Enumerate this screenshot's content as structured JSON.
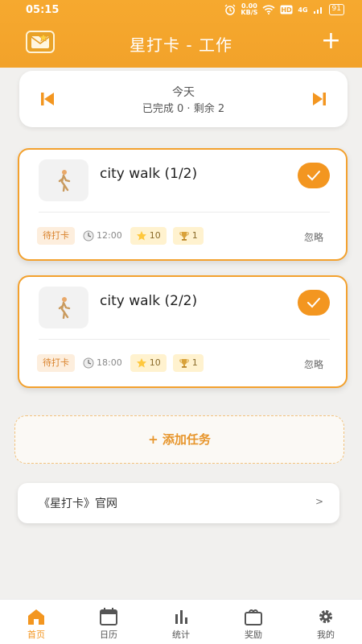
{
  "status_bar": {
    "time": "05:15",
    "speed_top": "0.00",
    "speed_bottom": "KB/S",
    "network": "4G",
    "battery": "91"
  },
  "header": {
    "title": "星打卡 - 工作",
    "add_label": "+"
  },
  "date_card": {
    "day_label": "今天",
    "summary": "已完成 0 · 剩余 2"
  },
  "tasks": [
    {
      "name": "city walk (1/2)",
      "status": "待打卡",
      "time": "12:00",
      "stars": "10",
      "trophies": "1",
      "ignore_label": "忽略"
    },
    {
      "name": "city walk (2/2)",
      "status": "待打卡",
      "time": "18:00",
      "stars": "10",
      "trophies": "1",
      "ignore_label": "忽略"
    }
  ],
  "add_task": {
    "label": "+ 添加任务"
  },
  "website": {
    "label": "《星打卡》官网",
    "chevron": ">"
  },
  "bottom_nav": {
    "items": [
      {
        "label": "首页",
        "icon": "home-icon"
      },
      {
        "label": "日历",
        "icon": "calendar-icon"
      },
      {
        "label": "统计",
        "icon": "stats-icon"
      },
      {
        "label": "奖励",
        "icon": "gift-icon"
      },
      {
        "label": "我的",
        "icon": "gear-icon"
      }
    ]
  },
  "colors": {
    "accent": "#f39620",
    "header": "#f6a92f",
    "background": "#f1f0ee"
  }
}
